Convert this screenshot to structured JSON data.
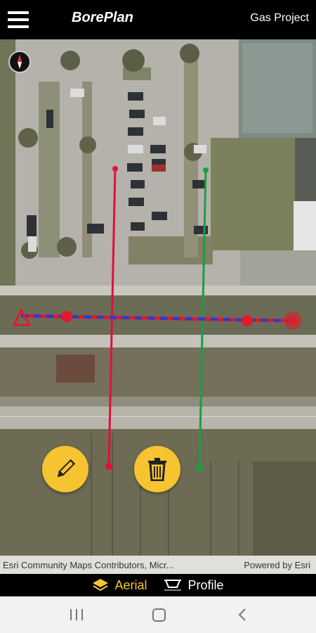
{
  "header": {
    "app_title": "BorePlan",
    "project_title": "Gas Project",
    "menu_icon": "hamburger-menu-icon"
  },
  "map": {
    "compass_icon": "compass-icon",
    "attribution_left": "Esri Community Maps Contributors, Micr...",
    "attribution_right": "Powered by Esri",
    "colors": {
      "red_line": "#e0103a",
      "green_line": "#1a9e45",
      "bore_red": "#e01b2a",
      "bore_blue": "#1f3ce0"
    }
  },
  "actions": {
    "edit_icon": "pencil-icon",
    "delete_icon": "trash-icon",
    "accent": "#f6c431"
  },
  "tabs": {
    "aerial": {
      "label": "Aerial",
      "icon": "layers-icon",
      "active": true
    },
    "profile": {
      "label": "Profile",
      "icon": "profile-icon",
      "active": false
    }
  },
  "system_nav": {
    "recent_icon": "recent-apps-icon",
    "home_icon": "home-icon",
    "back_icon": "back-icon"
  }
}
